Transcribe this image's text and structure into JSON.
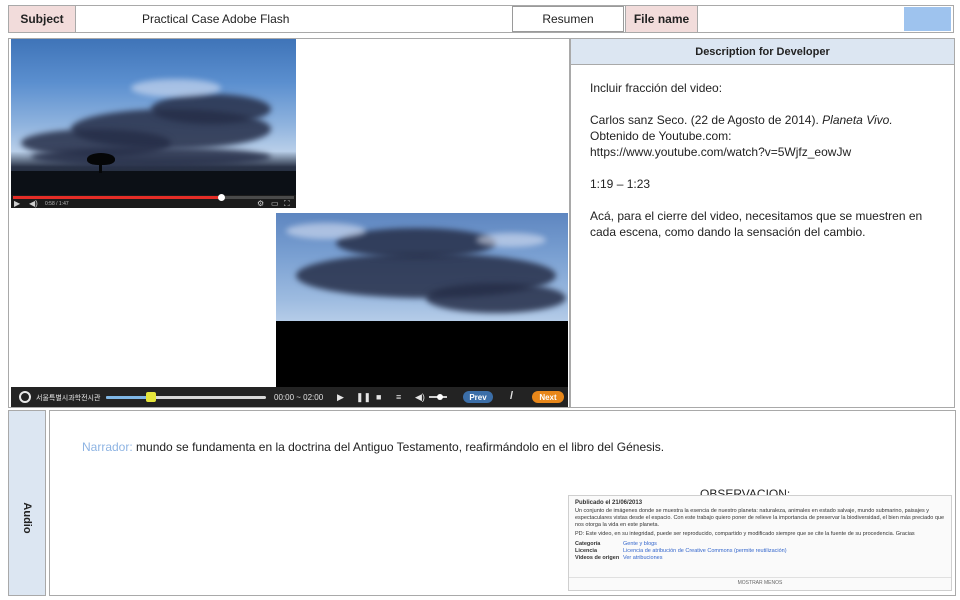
{
  "header": {
    "subject_label": "Subject",
    "subject_value": "Practical Case Adobe Flash",
    "resumen_label": "Resumen",
    "file_name_label": "File name",
    "file_name_value": ""
  },
  "developer": {
    "heading": "Description for Developer",
    "paragraphs": [
      "Incluir fracción del video:",
      "Carlos sanz Seco. (22 de Agosto de 2014). ",
      "Planeta Vivo.",
      "Obtenido de Youtube.com:",
      "https://www.youtube.com/watch?v=5Wjfz_eowJw",
      "1:19 – 1:23",
      "Acá, para el cierre del video, necesitamos que se muestren en cada escena, como dando la sensación del cambio."
    ]
  },
  "video_thumb": {
    "progress": 0.74,
    "time": "0:58 / 1:47"
  },
  "player": {
    "logo_text": "서울특별시과학전시관",
    "time": "00:00 ~ 02:00",
    "progress": 0.28,
    "prev_label": "Prev",
    "separator": "/",
    "next_label": "Next"
  },
  "audio": {
    "label": "Audio",
    "narrator_label": "Narrador:",
    "narration": "mundo se fundamenta en la doctrina del Antiguo Testamento, reafirmándolo en el libro del Génesis.",
    "observation_title": "OBSERVACION:"
  },
  "observation_card": {
    "published": "Publicado el 21/06/2013",
    "body": "Un conjunto de imágenes donde se muestra la esencia de nuestro planeta: naturaleza, animales en estado salvaje, mundo submarino, paisajes y espectaculares vistas desde el espacio. Con este trabajo quiero poner de relieve la importancia de preservar la biodiversidad, el bien más preciado que nos otorga la vida en este planeta.",
    "license_note": "PD: Este video, en su integridad, puede ser reproducido, compartido y modificado siempre que se cite la fuente de su procedencia. Gracias",
    "meta": [
      {
        "k": "Categoría",
        "v": "Gente y blogs"
      },
      {
        "k": "Licencia",
        "v": "Licencia de atribución de Creative Commons (permite reutilización)"
      },
      {
        "k": "Videos de origen",
        "v": "Ver atribuciones"
      }
    ],
    "show_less": "MOSTRAR MENOS"
  }
}
